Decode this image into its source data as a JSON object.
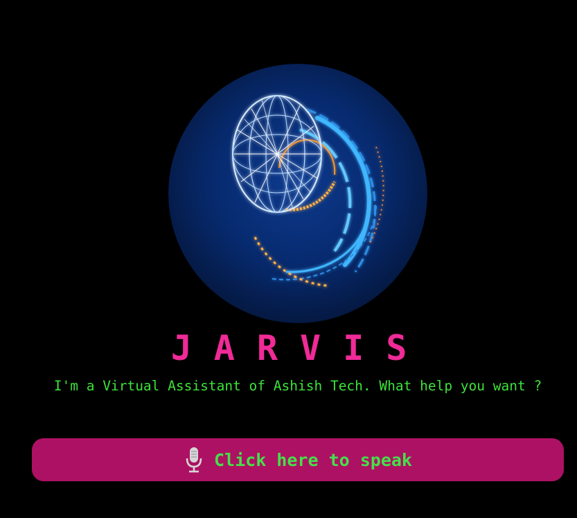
{
  "hero": {
    "title": "JARVIS",
    "subtitle": "I'm a Virtual Assistant of Ashish Tech. What help you want ?"
  },
  "speak_button": {
    "label": "Click here to speak",
    "icon": "microphone-icon"
  },
  "colors": {
    "background": "#000000",
    "title": "#f02a97",
    "subtitle": "#3de23a",
    "button_bg": "#ad1163",
    "button_text": "#45e04a",
    "avatar_bg": "#072a6e",
    "hologram_blue": "#3fb6ff",
    "hologram_orange": "#ffb347"
  }
}
